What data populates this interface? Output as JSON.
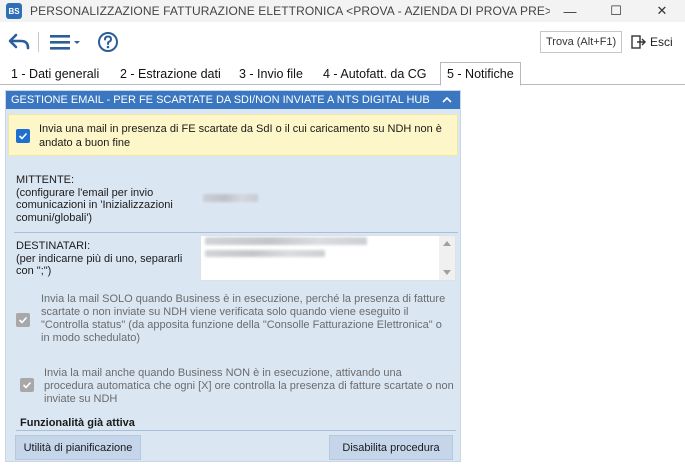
{
  "window": {
    "app_icon_text": "BS",
    "title": "PERSONALIZZAZIONE FATTURAZIONE ELETTRONICA <PROVA - AZIENDA DI PROVA PRE>",
    "minimize": "—",
    "maximize": "☐",
    "close": "✕"
  },
  "toolbar": {
    "back_icon": "back-arrow-icon",
    "menu_icon": "hamburger-menu-icon",
    "help_icon": "help-icon",
    "search_label": "Trova (Alt+F1)",
    "exit_label": "Esci"
  },
  "tabs": [
    {
      "label": "1 - Dati generali",
      "active": false
    },
    {
      "label": "2 - Estrazione dati",
      "active": false
    },
    {
      "label": "3 - Invio file",
      "active": false
    },
    {
      "label": "4 - Autofatt. da CG",
      "active": false
    },
    {
      "label": "5 - Notifiche",
      "active": true
    }
  ],
  "panel": {
    "header": "GESTIONE EMAIL - PER FE SCARTATE DA SDI/NON INVIATE A NTS DIGITAL HUB",
    "send_mail_checkbox": {
      "checked": true,
      "label": "Invia una mail in presenza di FE scartate da SdI o il cui caricamento su NDH non è andato a buon fine"
    },
    "mittente": {
      "label_line1": "MITTENTE:",
      "label_line2": "(configurare l'email per invio comunicazioni in 'Inizializzazioni comuni/globali')"
    },
    "destinatari": {
      "label_line1": "DESTINATARI:",
      "label_line2": "(per indicarne più di uno, separarli con \";\")"
    },
    "only_running_checkbox": {
      "checked": true,
      "disabled": true,
      "label": "Invia la mail SOLO quando Business è in esecuzione, perché la presenza di fatture scartate o non inviate su NDH viene verificata solo quando viene eseguito il \"Controlla status\" (da apposita funzione della \"Consolle Fatturazione Elettronica\" o in modo schedulato)"
    },
    "not_running_checkbox": {
      "checked": true,
      "disabled": true,
      "label": "Invia la mail anche quando Business NON è in esecuzione, attivando una procedura automatica che ogni [X] ore controlla la presenza di fatture scartate o non inviate su NDH"
    },
    "status_title": "Funzionalità già attiva",
    "scheduler_button": "Utilità di pianificazione",
    "disable_button": "Disabilita procedura"
  },
  "colors": {
    "panel_header": "#3a77c0",
    "panel_bg": "#dbe6f3",
    "highlight_bg": "#fdf6c9",
    "checkbox_on": "#1f6fd1",
    "button_bg": "#c6d6ea"
  }
}
